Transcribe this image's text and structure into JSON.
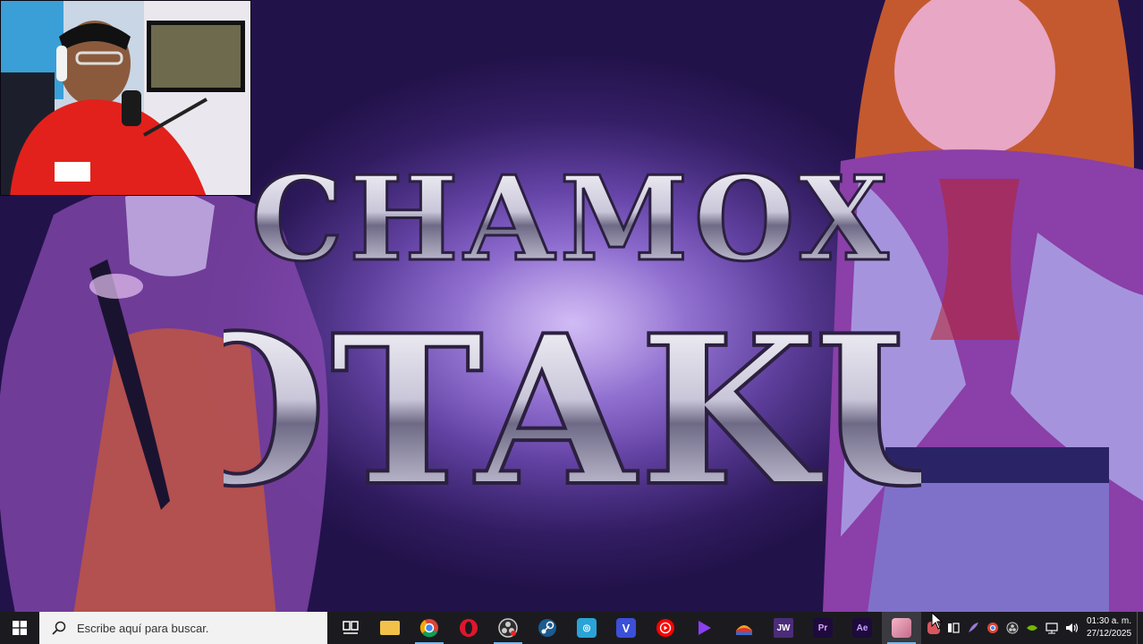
{
  "wallpaper": {
    "title_line1": "CHAMOX",
    "title_line2": "OTAKU",
    "accent": "#7a4fd0"
  },
  "webcam": {
    "icon": "webcam-overlay"
  },
  "taskbar": {
    "start_icon": "windows-logo-icon",
    "search_placeholder": "Escribe aquí para buscar.",
    "search_icon": "search-icon",
    "apps": [
      {
        "name": "task-view",
        "label": ""
      },
      {
        "name": "file-explorer",
        "label": ""
      },
      {
        "name": "chrome",
        "label": ""
      },
      {
        "name": "opera",
        "label": ""
      },
      {
        "name": "obs",
        "label": ""
      },
      {
        "name": "steam",
        "label": ""
      },
      {
        "name": "app-blue",
        "label": ""
      },
      {
        "name": "vegas",
        "label": "V"
      },
      {
        "name": "youtube-music",
        "label": ""
      },
      {
        "name": "app-purple",
        "label": ""
      },
      {
        "name": "app-multicolor",
        "label": ""
      },
      {
        "name": "jw",
        "label": "JW"
      },
      {
        "name": "premiere",
        "label": "Pr"
      },
      {
        "name": "after-effects",
        "label": "Ae"
      },
      {
        "name": "image-viewer",
        "label": ""
      }
    ],
    "time": "01:30 a. m.",
    "date": "27/12/2025"
  }
}
